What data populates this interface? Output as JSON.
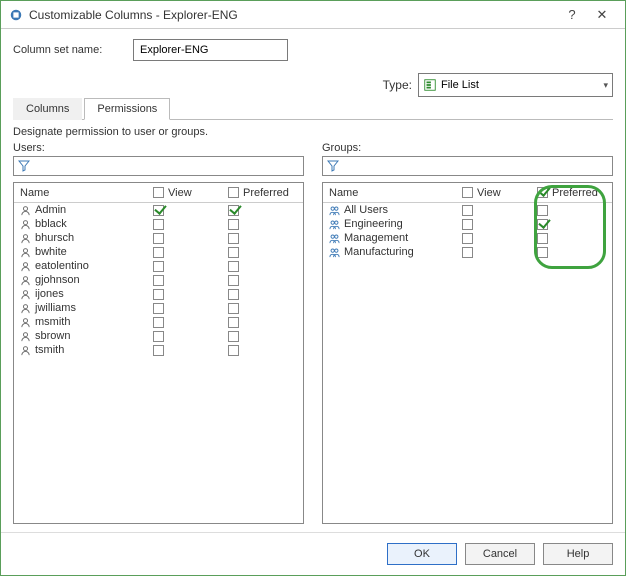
{
  "window": {
    "title": "Customizable Columns - Explorer-ENG"
  },
  "columnSet": {
    "label": "Column set name:",
    "value": "Explorer-ENG"
  },
  "type": {
    "label": "Type:",
    "value": "File List"
  },
  "tabs": {
    "columns": "Columns",
    "permissions": "Permissions"
  },
  "description": "Designate permission to user or groups.",
  "usersPanel": {
    "label": "Users:",
    "headers": {
      "name": "Name",
      "view": "View",
      "preferred": "Preferred"
    },
    "rows": [
      {
        "name": "Admin",
        "view": true,
        "preferred": true
      },
      {
        "name": "bblack",
        "view": false,
        "preferred": false
      },
      {
        "name": "bhursch",
        "view": false,
        "preferred": false
      },
      {
        "name": "bwhite",
        "view": false,
        "preferred": false
      },
      {
        "name": "eatolentino",
        "view": false,
        "preferred": false
      },
      {
        "name": "gjohnson",
        "view": false,
        "preferred": false
      },
      {
        "name": "ijones",
        "view": false,
        "preferred": false
      },
      {
        "name": "jwilliams",
        "view": false,
        "preferred": false
      },
      {
        "name": "msmith",
        "view": false,
        "preferred": false
      },
      {
        "name": "sbrown",
        "view": false,
        "preferred": false
      },
      {
        "name": "tsmith",
        "view": false,
        "preferred": false
      }
    ]
  },
  "groupsPanel": {
    "label": "Groups:",
    "headers": {
      "name": "Name",
      "view": "View",
      "preferred": "Preferred"
    },
    "rows": [
      {
        "name": "All Users",
        "view": false,
        "preferred": false
      },
      {
        "name": "Engineering",
        "view": false,
        "preferred": true
      },
      {
        "name": "Management",
        "view": false,
        "preferred": false
      },
      {
        "name": "Manufacturing",
        "view": false,
        "preferred": false
      }
    ]
  },
  "buttons": {
    "ok": "OK",
    "cancel": "Cancel",
    "help": "Help"
  }
}
